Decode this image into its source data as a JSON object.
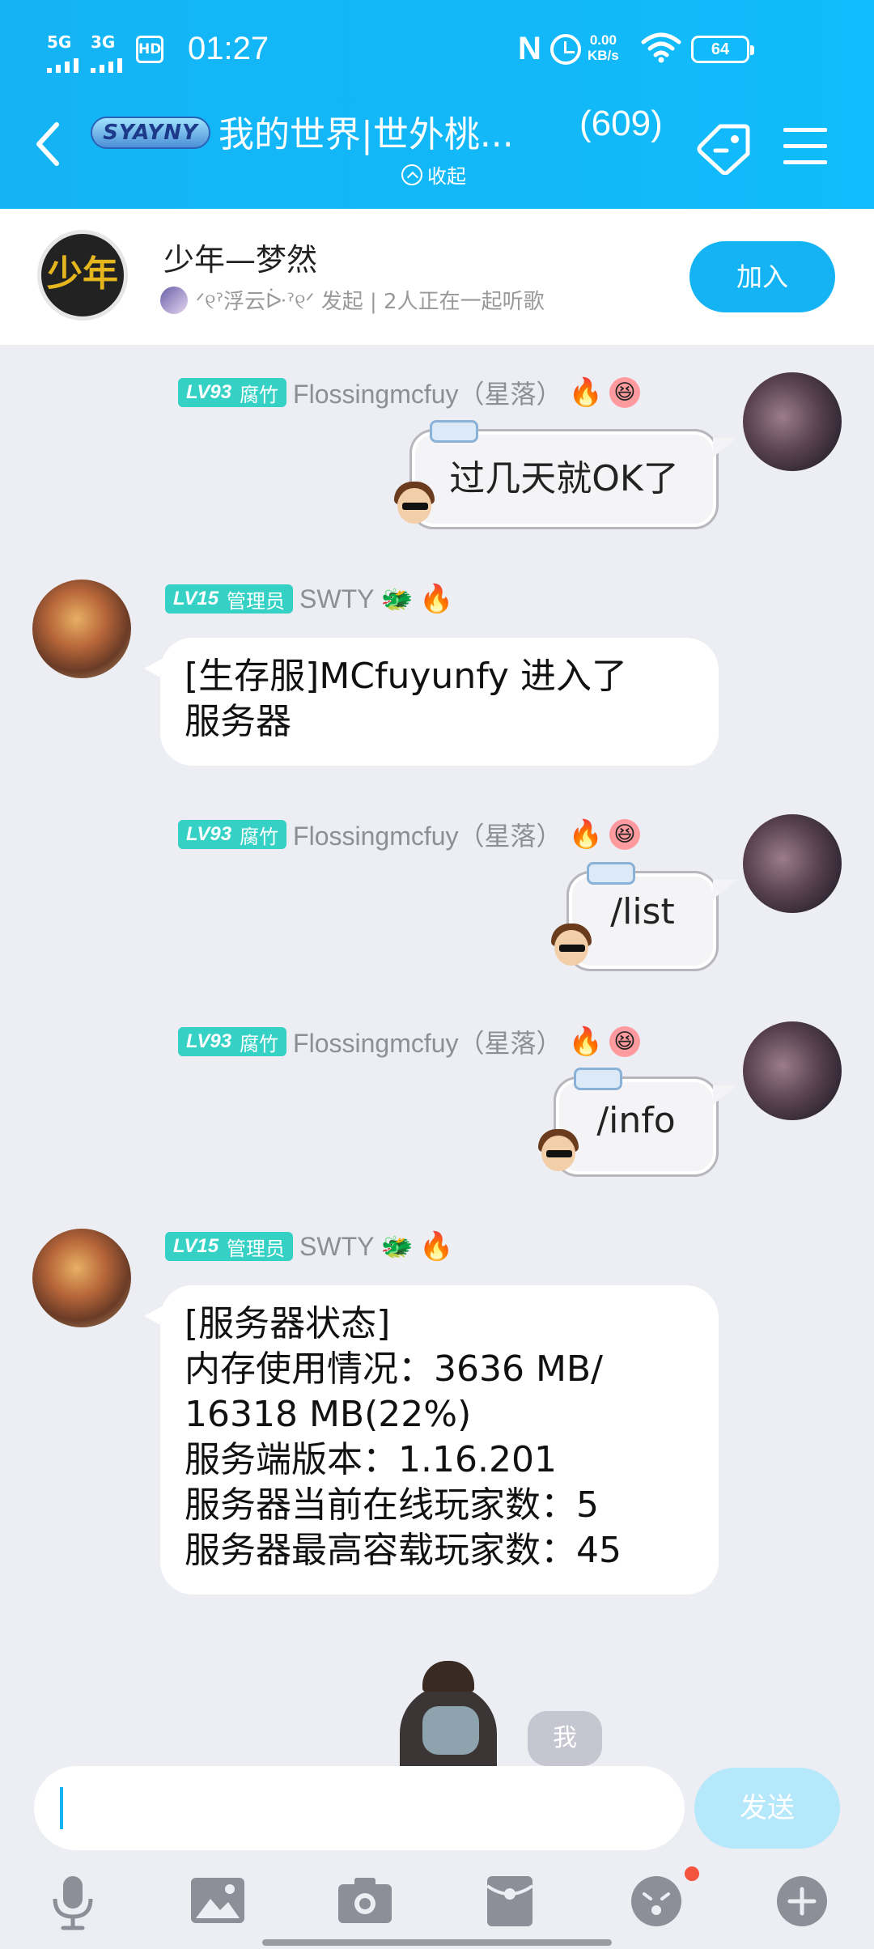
{
  "status_bar": {
    "sim1": "5G",
    "sim2": "3G",
    "hd": "HD",
    "hd_sub": "1",
    "time": "01:27",
    "nfc": "N",
    "speed_value": "0.00",
    "speed_unit": "KB/s",
    "battery": "64"
  },
  "header": {
    "logo_text": "SYAYNY",
    "title": "我的世界|世外桃...",
    "member_count": "(609)",
    "collapse_label": "收起"
  },
  "banner": {
    "avatar_text": "少年",
    "title": "少年—梦然",
    "subtitle": "ᐟ୧ˀ浮云ᐕˀ୧ᐟ 发起 | 2人正在一起听歌",
    "join_label": "加入"
  },
  "messages": [
    {
      "side": "right",
      "level": "LV93",
      "title": "腐竹",
      "nickname": "Flossingmcfuy（星落）",
      "text": "过几天就OK了"
    },
    {
      "side": "left",
      "level": "LV15",
      "title": "管理员",
      "nickname": "SWTY",
      "lines": [
        "[生存服]MCfuyunfy 进入了",
        "服务器"
      ]
    },
    {
      "side": "right",
      "level": "LV93",
      "title": "腐竹",
      "nickname": "Flossingmcfuy（星落）",
      "text": "/list"
    },
    {
      "side": "right",
      "level": "LV93",
      "title": "腐竹",
      "nickname": "Flossingmcfuy（星落）",
      "text": "/info"
    },
    {
      "side": "left",
      "level": "LV15",
      "title": "管理员",
      "nickname": "SWTY",
      "lines": [
        "[服务器状态]",
        "内存使用情况：3636 MB/",
        "16318 MB(22%)",
        "服务端版本：1.16.201",
        "服务器当前在线玩家数：5",
        "服务器最高容载玩家数：45"
      ]
    }
  ],
  "sticker_label": "我",
  "input": {
    "placeholder": "",
    "send_label": "发送"
  },
  "toolbar_icons": [
    "microphone-icon",
    "image-icon",
    "camera-icon",
    "red-packet-icon",
    "emoji-icon",
    "plus-icon"
  ],
  "colors": {
    "accent": "#14b4f4",
    "level_badge": "#35d1c5",
    "notification_dot": "#f4533d"
  }
}
